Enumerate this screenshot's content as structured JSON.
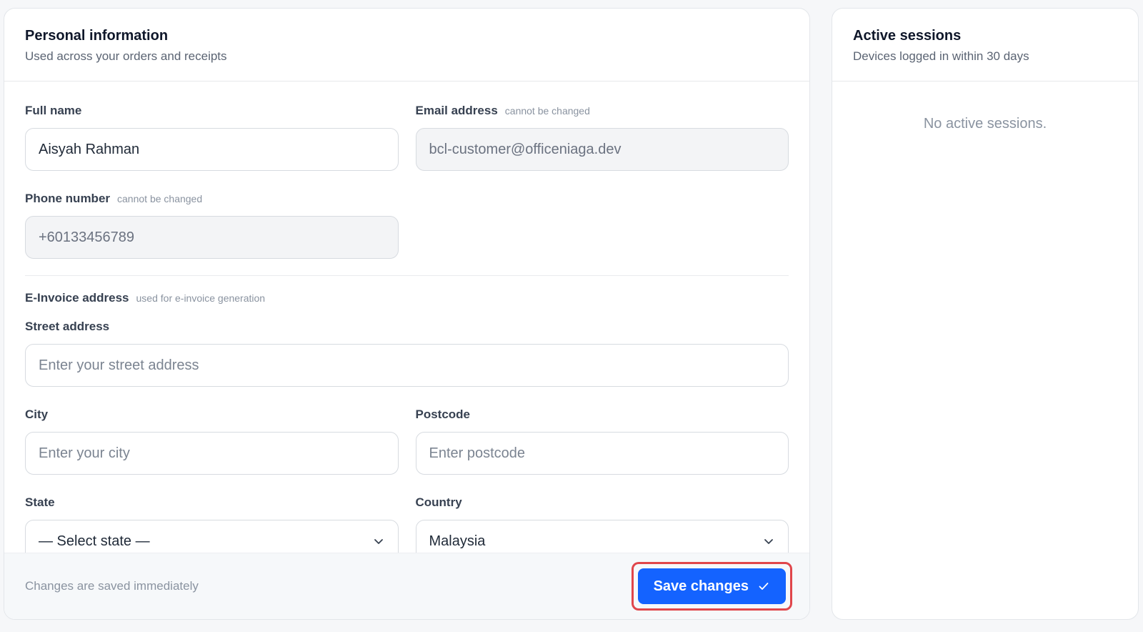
{
  "personal": {
    "title": "Personal information",
    "subtitle": "Used across your orders and receipts",
    "full_name": {
      "label": "Full name",
      "value": "Aisyah Rahman"
    },
    "email": {
      "label": "Email address",
      "hint": "cannot be changed",
      "value": "bcl-customer@officeniaga.dev"
    },
    "phone": {
      "label": "Phone number",
      "hint": "cannot be changed",
      "value": "+60133456789"
    },
    "einvoice": {
      "section_label": "E-Invoice address",
      "section_hint": "used for e-invoice generation",
      "street": {
        "label": "Street address",
        "placeholder": "Enter your street address"
      },
      "city": {
        "label": "City",
        "placeholder": "Enter your city"
      },
      "postcode": {
        "label": "Postcode",
        "placeholder": "Enter postcode"
      },
      "state": {
        "label": "State",
        "selected": "— Select state —"
      },
      "country": {
        "label": "Country",
        "selected": "Malaysia"
      }
    },
    "footer": {
      "note": "Changes are saved immediately",
      "save_label": "Save changes",
      "save_icon": "check-icon"
    }
  },
  "sessions": {
    "title": "Active sessions",
    "subtitle": "Devices logged in within 30 days",
    "empty": "No active sessions."
  },
  "colors": {
    "accent": "#1463ff",
    "highlight": "#e0464b",
    "muted_text": "#8a93a0"
  }
}
